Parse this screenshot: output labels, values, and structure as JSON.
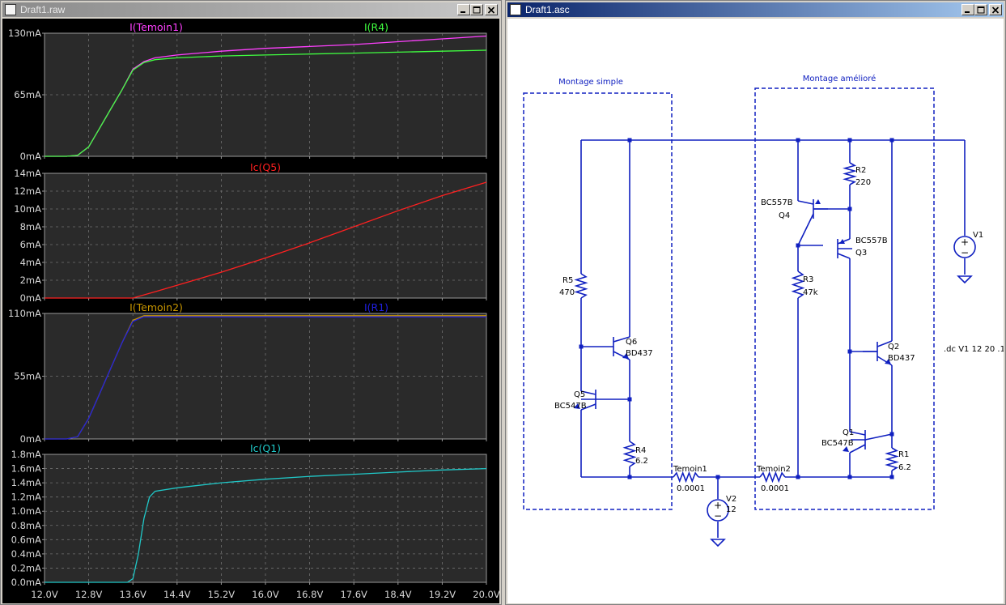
{
  "left_window": {
    "title": "Draft1.raw",
    "icon": "waveform-icon",
    "buttons": [
      "minimize-icon",
      "maximize-icon",
      "close-icon"
    ]
  },
  "right_window": {
    "title": "Draft1.asc",
    "icon": "schematic-icon",
    "buttons": [
      "minimize-icon",
      "maximize-icon",
      "close-icon"
    ]
  },
  "colors": {
    "magenta": "#ff40ff",
    "green": "#40ff40",
    "red": "#ff2020",
    "gold": "#c89600",
    "blue": "#2020e0",
    "cyan": "#20c8c8",
    "wire": "#1020c0",
    "plot_bg": "#000000",
    "pane_bg": "#2a2a2a"
  },
  "x_axis": {
    "ticks": [
      "12.0V",
      "12.8V",
      "13.6V",
      "14.4V",
      "15.2V",
      "16.0V",
      "16.8V",
      "17.6V",
      "18.4V",
      "19.2V",
      "20.0V"
    ]
  },
  "chart_data": [
    {
      "type": "line",
      "title": "",
      "xlabel": "",
      "ylabel": "",
      "xlim": [
        12,
        20
      ],
      "ylim": [
        0,
        130
      ],
      "y_ticks": [
        "0mA",
        "65mA",
        "130mA"
      ],
      "grid": true,
      "x": [
        12.0,
        12.4,
        12.6,
        12.8,
        13.0,
        13.2,
        13.4,
        13.6,
        13.8,
        14.0,
        14.4,
        15.2,
        16.0,
        16.8,
        17.6,
        18.4,
        19.2,
        20.0
      ],
      "series": [
        {
          "name": "I(Temoin1)",
          "color": "#ff40ff",
          "values": [
            0,
            0,
            1,
            10,
            30,
            50,
            70,
            92,
            100,
            104,
            107,
            111,
            114,
            116,
            118,
            121,
            124,
            127
          ]
        },
        {
          "name": "I(R4)",
          "color": "#40ff40",
          "values": [
            0,
            0,
            1,
            10,
            30,
            50,
            70,
            91,
            99,
            102,
            104,
            106,
            107,
            108,
            109,
            110,
            111,
            112
          ]
        }
      ]
    },
    {
      "type": "line",
      "title": "",
      "xlabel": "",
      "ylabel": "",
      "xlim": [
        12,
        20
      ],
      "ylim": [
        0,
        14
      ],
      "y_ticks": [
        "0mA",
        "2mA",
        "4mA",
        "6mA",
        "8mA",
        "10mA",
        "12mA",
        "14mA"
      ],
      "grid": true,
      "x": [
        12.0,
        13.0,
        13.6,
        14.0,
        15.2,
        16.0,
        16.8,
        17.6,
        18.4,
        19.2,
        20.0
      ],
      "series": [
        {
          "name": "Ic(Q5)",
          "color": "#ff2020",
          "values": [
            0,
            0,
            0,
            0.7,
            2.9,
            4.5,
            6.2,
            8.0,
            9.8,
            11.5,
            13.0
          ]
        }
      ]
    },
    {
      "type": "line",
      "title": "",
      "xlabel": "",
      "ylabel": "",
      "xlim": [
        12,
        20
      ],
      "ylim": [
        0,
        110
      ],
      "y_ticks": [
        "0mA",
        "55mA",
        "110mA"
      ],
      "grid": true,
      "x": [
        12.0,
        12.4,
        12.6,
        12.8,
        13.0,
        13.2,
        13.4,
        13.6,
        13.8,
        14.0,
        14.4,
        15.2,
        16.0,
        16.8,
        17.6,
        18.4,
        19.2,
        20.0
      ],
      "series": [
        {
          "name": "I(Temoin2)",
          "color": "#c89600",
          "values": [
            0,
            0,
            2,
            18,
            40,
            62,
            84,
            104,
            108,
            108,
            108,
            108,
            108,
            108,
            108,
            108,
            108,
            108
          ]
        },
        {
          "name": "I(R1)",
          "color": "#2020e0",
          "values": [
            0,
            0,
            2,
            18,
            40,
            62,
            84,
            103,
            107,
            107,
            107,
            107,
            107,
            107,
            107,
            107,
            107,
            107
          ]
        }
      ]
    },
    {
      "type": "line",
      "title": "",
      "xlabel": "",
      "ylabel": "",
      "xlim": [
        12,
        20
      ],
      "ylim": [
        0,
        1.8
      ],
      "y_ticks": [
        "0.0mA",
        "0.2mA",
        "0.4mA",
        "0.6mA",
        "0.8mA",
        "1.0mA",
        "1.2mA",
        "1.4mA",
        "1.6mA",
        "1.8mA"
      ],
      "grid": true,
      "x": [
        12.0,
        13.2,
        13.5,
        13.6,
        13.7,
        13.8,
        13.9,
        14.0,
        14.4,
        15.2,
        16.0,
        16.8,
        17.6,
        18.4,
        19.2,
        20.0
      ],
      "series": [
        {
          "name": "Ic(Q1)",
          "color": "#20c8c8",
          "values": [
            0,
            0,
            0,
            0.05,
            0.4,
            0.9,
            1.2,
            1.28,
            1.33,
            1.4,
            1.45,
            1.49,
            1.52,
            1.55,
            1.58,
            1.6
          ]
        }
      ]
    }
  ],
  "schematic": {
    "box_labels": [
      "Montage simple",
      "Montage amélioré"
    ],
    "components": [
      {
        "ref": "R5",
        "value": "470"
      },
      {
        "ref": "Q6",
        "value": "BD437"
      },
      {
        "ref": "Q5",
        "value": "BC547B"
      },
      {
        "ref": "R4",
        "value": "6.2"
      },
      {
        "ref": "Temoin1",
        "value": "0.0001"
      },
      {
        "ref": "V2",
        "value": "12"
      },
      {
        "ref": "Temoin2",
        "value": "0.0001"
      },
      {
        "ref": "Q4",
        "value": "BC557B"
      },
      {
        "ref": "Q3",
        "value": "BC557B"
      },
      {
        "ref": "R2",
        "value": "220"
      },
      {
        "ref": "R3",
        "value": "47k"
      },
      {
        "ref": "Q2",
        "value": "BD437"
      },
      {
        "ref": "Q1",
        "value": "BC547B"
      },
      {
        "ref": "R1",
        "value": "6.2"
      },
      {
        "ref": "V1",
        "value": ""
      }
    ],
    "directive": ".dc V1 12 20 .1"
  }
}
